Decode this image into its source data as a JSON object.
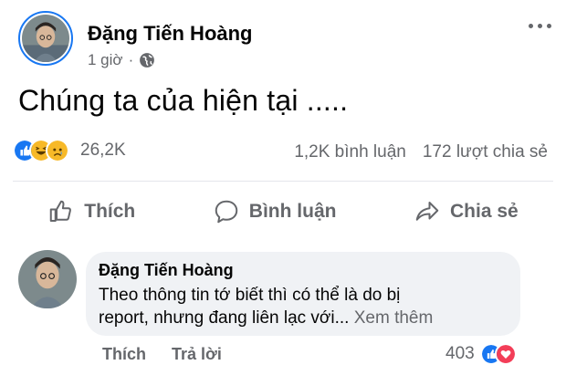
{
  "post": {
    "author": "Đặng Tiến Hoàng",
    "time": "1 giờ",
    "separator": "·",
    "text": "Chúng ta của hiện tại .....",
    "reaction_count": "26,2K",
    "comments_count": "1,2K bình luận",
    "shares_count": "172 lượt chia sẻ",
    "reaction_icons": [
      "like-icon",
      "haha-icon",
      "sad-icon"
    ]
  },
  "actions": {
    "like": "Thích",
    "comment": "Bình luận",
    "share": "Chia sẻ"
  },
  "comment": {
    "author": "Đặng Tiến Hoàng",
    "text_line1": "Theo thông tin tớ biết thì có thể là do bị",
    "text_line2": "report, nhưng đang liên lạc với...",
    "see_more": "Xem thêm",
    "like_label": "Thích",
    "reply_label": "Trả lời",
    "reaction_count": "403",
    "reaction_icons": [
      "like-icon",
      "love-icon"
    ]
  },
  "colors": {
    "brand_blue": "#1877f2",
    "secondary_text": "#65676b",
    "bubble_bg": "#f0f2f5",
    "love_red": "#f33e58",
    "haha_yellow": "#f7b928"
  }
}
